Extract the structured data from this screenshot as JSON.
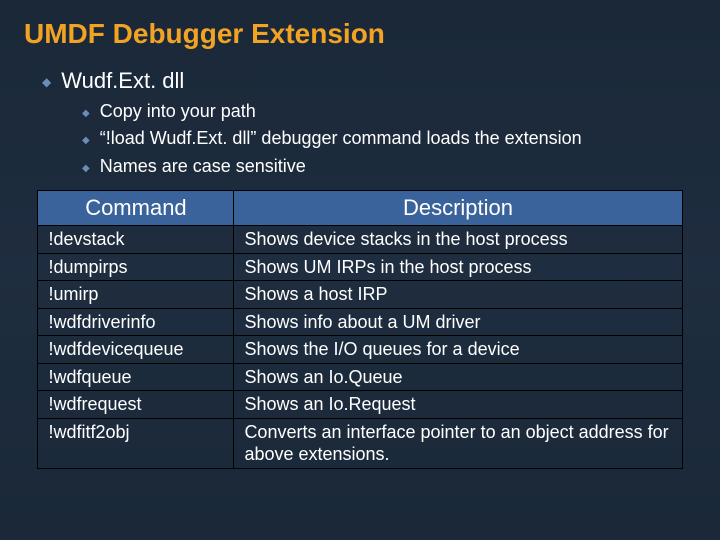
{
  "title": "UMDF Debugger Extension",
  "main_bullet": "Wudf.Ext. dll",
  "sub_bullets": [
    "Copy into your path",
    "“!load Wudf.Ext. dll” debugger command loads the extension",
    "Names are case sensitive"
  ],
  "table": {
    "headers": {
      "command": "Command",
      "description": "Description"
    },
    "rows": [
      {
        "cmd": "!devstack",
        "desc": "Shows device stacks in the host process"
      },
      {
        "cmd": "!dumpirps",
        "desc": "Shows UM IRPs in the host process"
      },
      {
        "cmd": "!umirp",
        "desc": "Shows a host IRP"
      },
      {
        "cmd": "!wdfdriverinfo",
        "desc": "Shows info about a UM driver"
      },
      {
        "cmd": "!wdfdevicequeue",
        "desc": "Shows the I/O queues for a device"
      },
      {
        "cmd": "!wdfqueue",
        "desc": "Shows an Io.Queue"
      },
      {
        "cmd": "!wdfrequest",
        "desc": "Shows an Io.Request"
      },
      {
        "cmd": "!wdfitf2obj",
        "desc": "Converts an interface pointer to an object address for above extensions."
      }
    ]
  }
}
